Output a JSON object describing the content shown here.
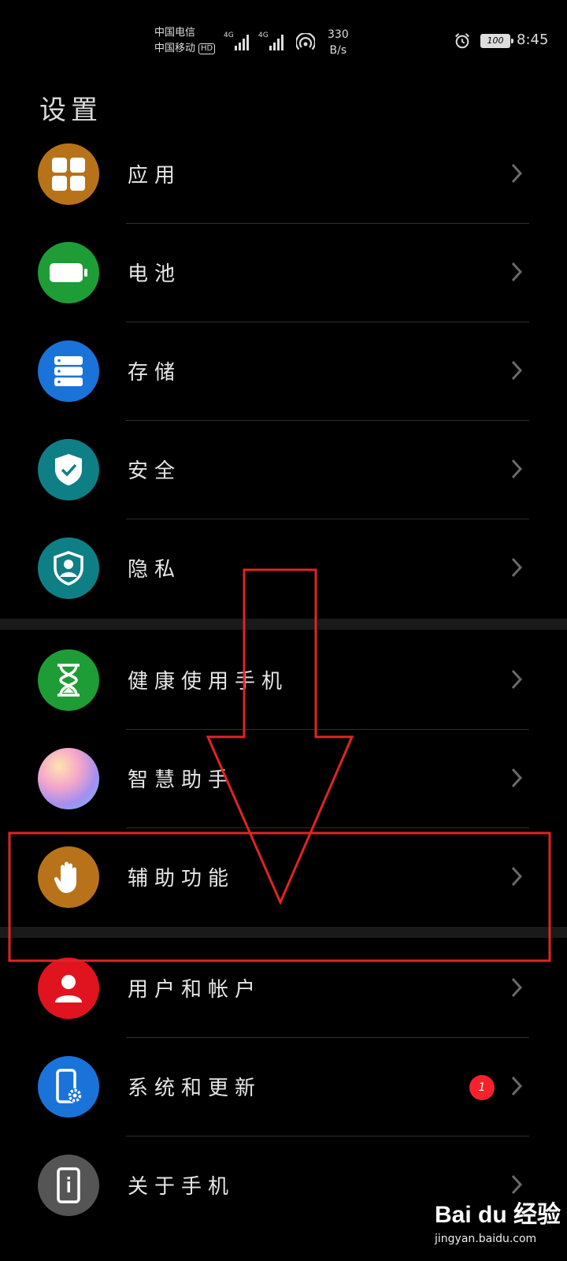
{
  "status_bar": {
    "carrier_1": "中国电信",
    "carrier_2": "中国移动",
    "hd_label": "HD",
    "network_1": "4G",
    "network_2": "4G",
    "speed_value": "330",
    "speed_unit": "B/s",
    "battery_level": "100",
    "time": "8:45"
  },
  "page_title": "设置",
  "items": [
    {
      "label": "应用",
      "icon": "apps-grid-icon",
      "color": "#b8731a"
    },
    {
      "label": "电池",
      "icon": "battery-icon",
      "color": "#1e9d36"
    },
    {
      "label": "存储",
      "icon": "storage-icon",
      "color": "#1a73d9"
    },
    {
      "label": "安全",
      "icon": "shield-check-icon",
      "color": "#0f7f86"
    },
    {
      "label": "隐私",
      "icon": "privacy-shield-icon",
      "color": "#0f7f86"
    },
    {
      "label": "健康使用手机",
      "icon": "hourglass-icon",
      "color": "#1e9d36"
    },
    {
      "label": "智慧助手",
      "icon": "assistant-orb-icon",
      "color": "#c9a3e0"
    },
    {
      "label": "辅助功能",
      "icon": "hand-icon",
      "color": "#b8731a"
    },
    {
      "label": "用户和帐户",
      "icon": "user-icon",
      "color": "#e0141e"
    },
    {
      "label": "系统和更新",
      "icon": "phone-settings-icon",
      "color": "#1a73d9",
      "badge": "1"
    },
    {
      "label": "关于手机",
      "icon": "phone-info-icon",
      "color": "#555555"
    }
  ],
  "watermark": {
    "brand": "Bai du 经验",
    "url": "jingyan.baidu.com"
  },
  "annotation_color": "#e02424"
}
